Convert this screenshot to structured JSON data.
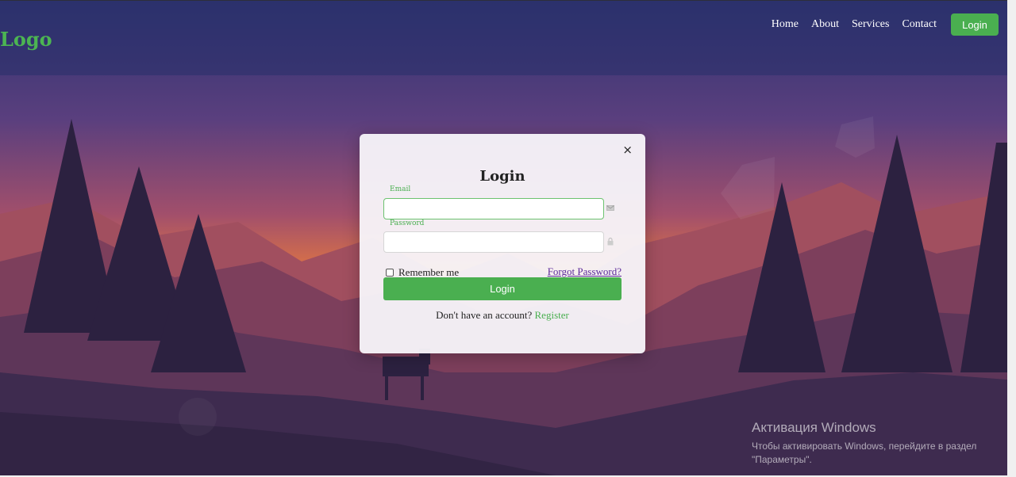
{
  "header": {
    "logo": "Logo",
    "nav": [
      "Home",
      "About",
      "Services",
      "Contact"
    ],
    "login_button": "Login"
  },
  "modal": {
    "close_icon": "close-icon",
    "close_label": "×",
    "title": "Login",
    "email_label": "Email",
    "email_value": "",
    "email_icon": "envelope-icon",
    "password_label": "Password",
    "password_value": "",
    "password_icon": "lock-icon",
    "remember_label": "Remember me",
    "forgot_label": "Forgot Password?",
    "submit_label": "Login",
    "no_account_text": "Don't have an account?",
    "register_label": "Register"
  },
  "watermark": {
    "title": "Активация Windows",
    "line1": "Чтобы активировать Windows, перейдите в раздел",
    "line2": "\"Параметры\"."
  },
  "colors": {
    "accent": "#4aaf50",
    "link_visited": "#5b2a9a"
  }
}
